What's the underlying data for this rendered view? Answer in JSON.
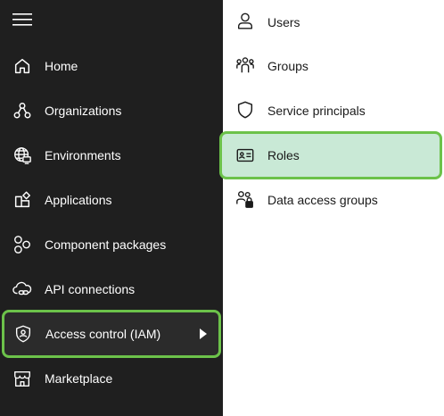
{
  "nav": {
    "menu_icon": "hamburger-icon",
    "items": [
      {
        "label": "Home",
        "icon": "home-icon"
      },
      {
        "label": "Organizations",
        "icon": "organizations-icon"
      },
      {
        "label": "Environments",
        "icon": "globe-icon"
      },
      {
        "label": "Applications",
        "icon": "applications-icon"
      },
      {
        "label": "Component packages",
        "icon": "component-packages-icon"
      },
      {
        "label": "API connections",
        "icon": "cloud-link-icon"
      },
      {
        "label": "Access control (IAM)",
        "icon": "shield-person-icon",
        "selected": true
      },
      {
        "label": "Marketplace",
        "icon": "store-icon"
      }
    ]
  },
  "submenu": {
    "items": [
      {
        "label": "Users",
        "icon": "person-icon"
      },
      {
        "label": "Groups",
        "icon": "people-group-icon"
      },
      {
        "label": "Service principals",
        "icon": "shield-icon"
      },
      {
        "label": "Roles",
        "icon": "id-card-icon",
        "selected": true
      },
      {
        "label": "Data access groups",
        "icon": "people-lock-icon"
      }
    ]
  },
  "colors": {
    "sidebar_bg": "#1f1f1f",
    "highlight_border": "#6cc24a",
    "selected_bg": "#c9e9d6"
  }
}
